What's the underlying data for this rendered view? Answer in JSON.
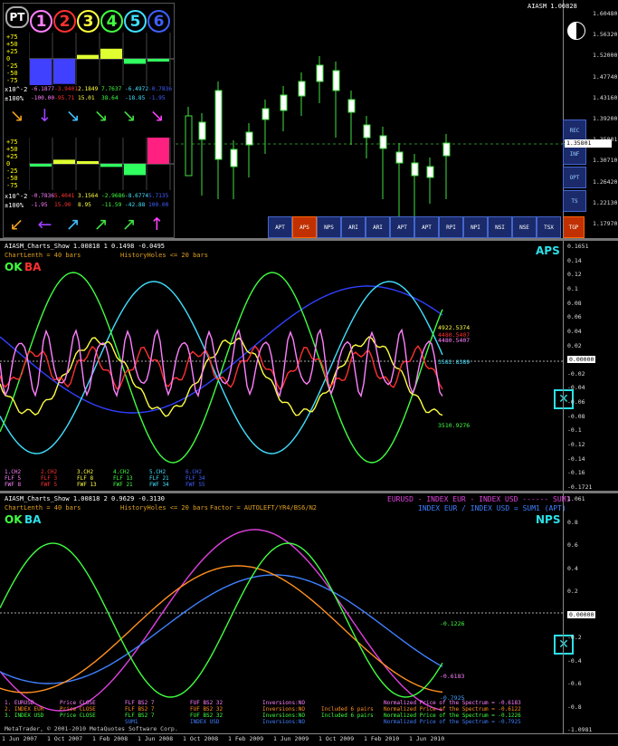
{
  "top": {
    "instrument_label": "AIASM 1.00828",
    "pt_label": "PT",
    "numbers": [
      {
        "label": "1",
        "color": "#ff80ff"
      },
      {
        "label": "2",
        "color": "#ff3030"
      },
      {
        "label": "3",
        "color": "#ffff40"
      },
      {
        "label": "4",
        "color": "#40ff40"
      },
      {
        "label": "5",
        "color": "#40e0ff"
      },
      {
        "label": "6",
        "color": "#4060ff"
      }
    ],
    "panel1": {
      "scale": [
        "+75",
        "+50",
        "+25",
        "0",
        "-25",
        "-50",
        "-75"
      ],
      "row_a_label": "x10^-2",
      "row_a": [
        "-6.1877",
        "-3.9401",
        "2.1849",
        "7.7637",
        "-6.4972",
        "-0.7836"
      ],
      "row_b_label": "±100%",
      "row_b": [
        "-100.00",
        "-95.71",
        "15.01",
        "38.64",
        "-18.85",
        "-1.95"
      ]
    },
    "panel2": {
      "scale": [
        "+75",
        "+50",
        "+25",
        "0",
        "-25",
        "-50",
        "-75"
      ],
      "row_a_label": "x10^-2",
      "row_a": [
        "-0.7836",
        "5.4041",
        "3.1564",
        "-2.9686",
        "-8.6774",
        "5.7135"
      ],
      "row_b_label": "±100%",
      "row_b": [
        "-1.95",
        "15.90",
        "8.95",
        "-11.59",
        "-42.88",
        "100.00"
      ]
    },
    "arrow_row1": [
      "↘",
      "↓",
      "↘",
      "↘",
      "↘",
      "↘"
    ],
    "arrow_row2": [
      "↙",
      "←",
      "↗",
      "↗",
      "↗",
      "↑"
    ],
    "buttons": [
      "APT",
      "APS",
      "NPS",
      "ARI",
      "ARI",
      "APT",
      "APT",
      "RPI",
      "NPI",
      "NSI",
      "NSE",
      "TSX"
    ],
    "tgp_label": "TGP",
    "side_buttons": [
      "REC",
      "INF",
      "OPT",
      "TS"
    ],
    "price_scale": [
      "1.60480",
      "1.56320",
      "1.52000",
      "1.47740",
      "1.43160",
      "1.39200",
      "1.35801",
      "1.30710",
      "1.26420",
      "1.22130",
      "1.17970"
    ],
    "current_price": "1.35801"
  },
  "aps": {
    "header": "AIASM_Charts_Show 1.00818 1 0.1498 -0.0495",
    "chart_length": "ChartLenth = 40 bars",
    "history_holes": "HistoryHoles <= 20 bars",
    "ok": "OK",
    "ba": "BA",
    "tag": "APS",
    "scale": [
      "0.1651",
      "0.14",
      "0.12",
      "0.1",
      "0.08",
      "0.06",
      "0.04",
      "0.02",
      "0.00000",
      "-0.02",
      "-0.04",
      "-0.06",
      "-0.08",
      "-0.1",
      "-0.12",
      "-0.14",
      "-0.16",
      "-0.1721"
    ],
    "line_labels": [
      {
        "text": "4922.5374",
        "color": "#ffff40"
      },
      {
        "text": "4480.5407",
        "color": "#ff3030"
      },
      {
        "text": "4480.5407",
        "color": "#ff80ff"
      },
      {
        "text": "3582.8389",
        "color": "#40e0ff"
      },
      {
        "text": "3510.9276",
        "color": "#40ff40"
      }
    ],
    "legend": [
      {
        "ch": "1.CH2",
        "flf": "FLF 5",
        "fwf": "FWF 8",
        "color": "#ff80ff"
      },
      {
        "ch": "2.CH2",
        "flf": "FLF 3",
        "fwf": "FWF 5",
        "color": "#ff3030"
      },
      {
        "ch": "3.CH2",
        "flf": "FLF 8",
        "fwf": "FWF 13",
        "color": "#ffff40"
      },
      {
        "ch": "4.CH2",
        "flf": "FLF 13",
        "fwf": "FWF 21",
        "color": "#40ff40"
      },
      {
        "ch": "5.CH2",
        "flf": "FLF 21",
        "fwf": "FWF 34",
        "color": "#40e0ff"
      },
      {
        "ch": "6.CH2",
        "flf": "FLF 34",
        "fwf": "FWF 55",
        "color": "#4060ff"
      }
    ]
  },
  "nps": {
    "header": "AIASM_Charts_Show 1.00818 2 0.9629 -0.3130",
    "chart_length": "ChartLenth = 40 bars",
    "history_holes": "HistoryHoles <= 20 bars",
    "factor": "Factor = AUTOLEFT/YR4/BS6/N2",
    "ok": "OK",
    "ba": "BA",
    "tag": "NPS",
    "title_line1": "EURUSD - INDEX EUR - INDEX USD ------ SUM1",
    "title_line2": "INDEX EUR / INDEX USD = SUM1 (APT)",
    "scale": [
      "1.061",
      "0.8",
      "0.6",
      "0.4",
      "0.2",
      "0.00000",
      "-0.2",
      "-0.4",
      "-0.6",
      "-0.8",
      "-1.0981"
    ],
    "line_labels": [
      {
        "text": "-0.1226",
        "color": "#40ff40"
      },
      {
        "text": "-0.6183",
        "color": "#ff80ff"
      },
      {
        "text": "-0.7925",
        "color": "#40a0ff"
      }
    ],
    "legend": [
      {
        "a": "1. EURUSD",
        "b": "Price CLOSE",
        "c": "FLF BS2 7",
        "d": "FUF BS2 32",
        "e": "Inversions:NO",
        "f": "",
        "g": "Normalized Price of the Spectrum = -0.6183",
        "color": "#ff80ff"
      },
      {
        "a": "2. INDEX EUR",
        "b": "Price CLOSE",
        "c": "FLF BS2 7",
        "d": "FUF BS2 32",
        "e": "Inversions:NO",
        "f": "Included 6 pairs",
        "g": "Normalized Price of the Spectrum = -0.6122",
        "color": "#ff9020"
      },
      {
        "a": "3. INDEX USD",
        "b": "Price CLOSE",
        "c": "FLF BS2 7",
        "d": "FUF BS2 32",
        "e": "Inversions:NO",
        "f": "Included 6 pairs",
        "g": "Normalized Price of the Spectrum = -0.1226",
        "color": "#40ff40"
      },
      {
        "a": "",
        "b": "",
        "c": "SUM1",
        "d": "INDEX USD",
        "e": "Inversions:NO",
        "f": "",
        "g": "Normalized Price of the Spectrum = -0.7925",
        "color": "#4080ff"
      }
    ],
    "copyright": "MetaTrader, © 2001-2010 MetaQuotes Software Corp."
  },
  "dates": [
    "1 Jun 2007",
    "1 Oct 2007",
    "1 Feb 2008",
    "1 Jun 2008",
    "1 Oct 2008",
    "1 Feb 2009",
    "1 Jun 2009",
    "1 Oct 2009",
    "1 Feb 2010",
    "1 Jun 2010"
  ]
}
